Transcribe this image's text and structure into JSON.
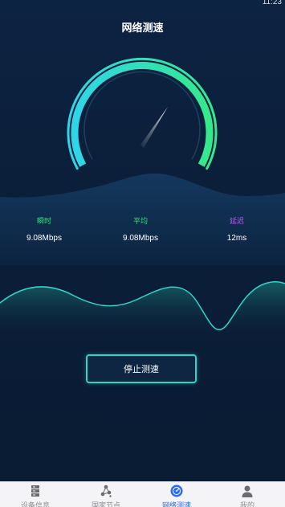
{
  "status_bar": {
    "time": "11:23"
  },
  "header": {
    "title": "网络测速"
  },
  "metrics": [
    {
      "label": "瞬时",
      "value": "9.08Mbps",
      "color": "#3ddc84"
    },
    {
      "label": "平均",
      "value": "9.08Mbps",
      "color": "#3ddc84"
    },
    {
      "label": "延迟",
      "value": "12ms",
      "color": "#b45cf0"
    }
  ],
  "actions": {
    "stop_label": "停止测速"
  },
  "tabs": [
    {
      "label": "设备信息",
      "icon": "device-info-icon",
      "active": false
    },
    {
      "label": "国家节点",
      "icon": "nodes-icon",
      "active": false
    },
    {
      "label": "网络测速",
      "icon": "speed-test-icon",
      "active": true
    },
    {
      "label": "我的",
      "icon": "profile-icon",
      "active": false
    }
  ],
  "colors": {
    "accent": "#2ed6c8",
    "tab_active": "#2a6df4",
    "gauge_start": "#2fd6e8",
    "gauge_end": "#36e88c"
  }
}
